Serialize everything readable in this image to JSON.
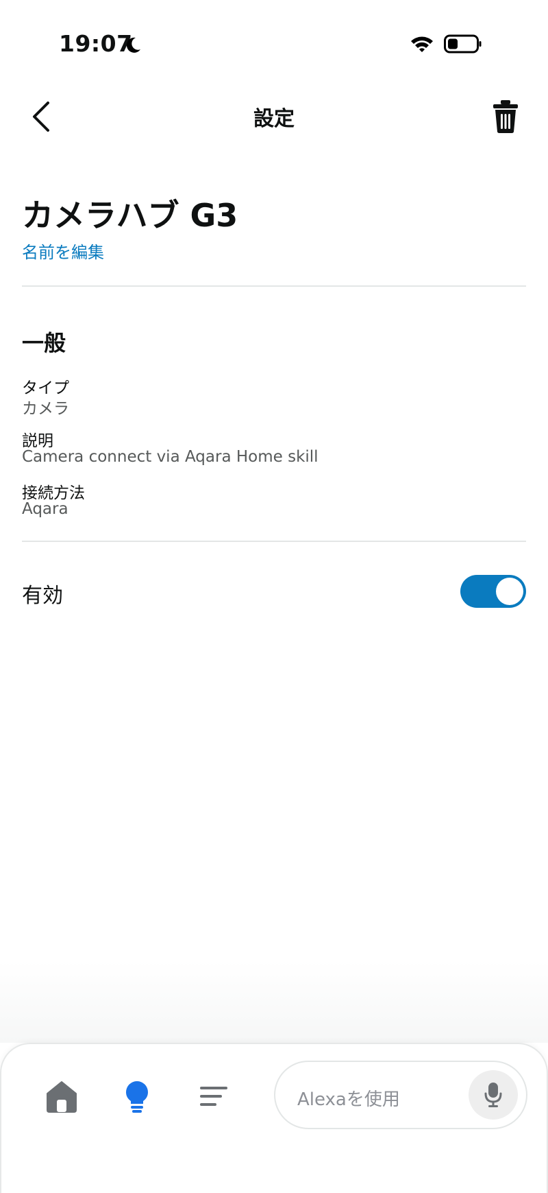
{
  "status_bar": {
    "time": "19:07"
  },
  "nav": {
    "title": "設定"
  },
  "device": {
    "name": "カメラハブ G3",
    "edit_link": "名前を編集"
  },
  "general": {
    "title": "一般",
    "fields": [
      {
        "label": "タイプ",
        "value": "カメラ"
      },
      {
        "label": "説明",
        "value": "Camera connect via Aqara Home skill"
      },
      {
        "label": "接続方法",
        "value": "Aqara"
      }
    ]
  },
  "enabled": {
    "label": "有効",
    "on": true
  },
  "bottom_nav": {
    "alexa_placeholder": "Alexaを使用",
    "active_item": "devices"
  },
  "colors": {
    "accent": "#0a7bbf",
    "active_icon": "#1a73e8",
    "text": "#0f1111",
    "secondary_text": "#565959"
  }
}
